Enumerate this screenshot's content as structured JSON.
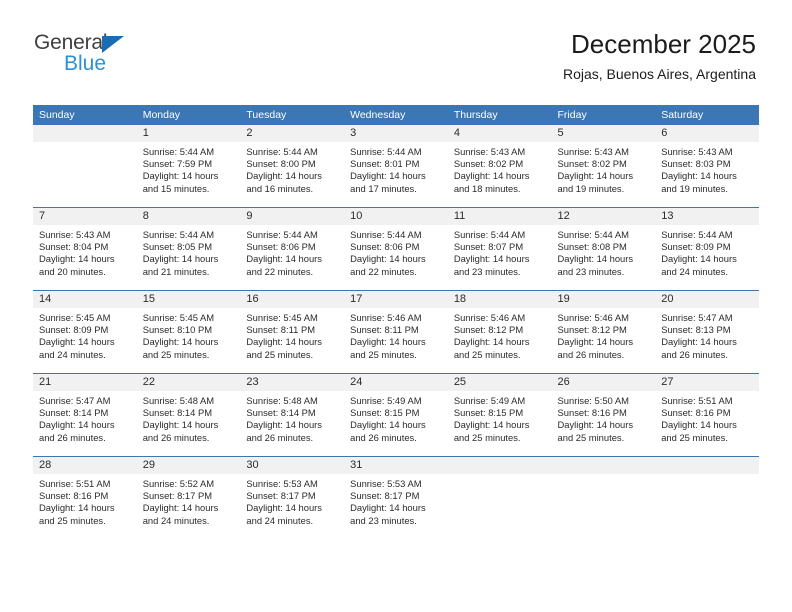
{
  "brand": {
    "name_top": "General",
    "name_bottom": "Blue",
    "accent_color": "#1a6cb5",
    "accent_light": "#2e8fd6"
  },
  "header": {
    "title": "December 2025",
    "subtitle": "Rojas, Buenos Aires, Argentina"
  },
  "theme": {
    "header_bg": "#3b77b5",
    "daynum_bg": "#f1f1f1",
    "text": "#2b2b2b"
  },
  "weekday_headers": [
    "Sunday",
    "Monday",
    "Tuesday",
    "Wednesday",
    "Thursday",
    "Friday",
    "Saturday"
  ],
  "weeks": [
    [
      {
        "day": "",
        "sunrise": "",
        "sunset": "",
        "daylight_line1": "",
        "daylight_line2": ""
      },
      {
        "day": "1",
        "sunrise": "Sunrise: 5:44 AM",
        "sunset": "Sunset: 7:59 PM",
        "daylight_line1": "Daylight: 14 hours",
        "daylight_line2": "and 15 minutes."
      },
      {
        "day": "2",
        "sunrise": "Sunrise: 5:44 AM",
        "sunset": "Sunset: 8:00 PM",
        "daylight_line1": "Daylight: 14 hours",
        "daylight_line2": "and 16 minutes."
      },
      {
        "day": "3",
        "sunrise": "Sunrise: 5:44 AM",
        "sunset": "Sunset: 8:01 PM",
        "daylight_line1": "Daylight: 14 hours",
        "daylight_line2": "and 17 minutes."
      },
      {
        "day": "4",
        "sunrise": "Sunrise: 5:43 AM",
        "sunset": "Sunset: 8:02 PM",
        "daylight_line1": "Daylight: 14 hours",
        "daylight_line2": "and 18 minutes."
      },
      {
        "day": "5",
        "sunrise": "Sunrise: 5:43 AM",
        "sunset": "Sunset: 8:02 PM",
        "daylight_line1": "Daylight: 14 hours",
        "daylight_line2": "and 19 minutes."
      },
      {
        "day": "6",
        "sunrise": "Sunrise: 5:43 AM",
        "sunset": "Sunset: 8:03 PM",
        "daylight_line1": "Daylight: 14 hours",
        "daylight_line2": "and 19 minutes."
      }
    ],
    [
      {
        "day": "7",
        "sunrise": "Sunrise: 5:43 AM",
        "sunset": "Sunset: 8:04 PM",
        "daylight_line1": "Daylight: 14 hours",
        "daylight_line2": "and 20 minutes."
      },
      {
        "day": "8",
        "sunrise": "Sunrise: 5:44 AM",
        "sunset": "Sunset: 8:05 PM",
        "daylight_line1": "Daylight: 14 hours",
        "daylight_line2": "and 21 minutes."
      },
      {
        "day": "9",
        "sunrise": "Sunrise: 5:44 AM",
        "sunset": "Sunset: 8:06 PM",
        "daylight_line1": "Daylight: 14 hours",
        "daylight_line2": "and 22 minutes."
      },
      {
        "day": "10",
        "sunrise": "Sunrise: 5:44 AM",
        "sunset": "Sunset: 8:06 PM",
        "daylight_line1": "Daylight: 14 hours",
        "daylight_line2": "and 22 minutes."
      },
      {
        "day": "11",
        "sunrise": "Sunrise: 5:44 AM",
        "sunset": "Sunset: 8:07 PM",
        "daylight_line1": "Daylight: 14 hours",
        "daylight_line2": "and 23 minutes."
      },
      {
        "day": "12",
        "sunrise": "Sunrise: 5:44 AM",
        "sunset": "Sunset: 8:08 PM",
        "daylight_line1": "Daylight: 14 hours",
        "daylight_line2": "and 23 minutes."
      },
      {
        "day": "13",
        "sunrise": "Sunrise: 5:44 AM",
        "sunset": "Sunset: 8:09 PM",
        "daylight_line1": "Daylight: 14 hours",
        "daylight_line2": "and 24 minutes."
      }
    ],
    [
      {
        "day": "14",
        "sunrise": "Sunrise: 5:45 AM",
        "sunset": "Sunset: 8:09 PM",
        "daylight_line1": "Daylight: 14 hours",
        "daylight_line2": "and 24 minutes."
      },
      {
        "day": "15",
        "sunrise": "Sunrise: 5:45 AM",
        "sunset": "Sunset: 8:10 PM",
        "daylight_line1": "Daylight: 14 hours",
        "daylight_line2": "and 25 minutes."
      },
      {
        "day": "16",
        "sunrise": "Sunrise: 5:45 AM",
        "sunset": "Sunset: 8:11 PM",
        "daylight_line1": "Daylight: 14 hours",
        "daylight_line2": "and 25 minutes."
      },
      {
        "day": "17",
        "sunrise": "Sunrise: 5:46 AM",
        "sunset": "Sunset: 8:11 PM",
        "daylight_line1": "Daylight: 14 hours",
        "daylight_line2": "and 25 minutes."
      },
      {
        "day": "18",
        "sunrise": "Sunrise: 5:46 AM",
        "sunset": "Sunset: 8:12 PM",
        "daylight_line1": "Daylight: 14 hours",
        "daylight_line2": "and 25 minutes."
      },
      {
        "day": "19",
        "sunrise": "Sunrise: 5:46 AM",
        "sunset": "Sunset: 8:12 PM",
        "daylight_line1": "Daylight: 14 hours",
        "daylight_line2": "and 26 minutes."
      },
      {
        "day": "20",
        "sunrise": "Sunrise: 5:47 AM",
        "sunset": "Sunset: 8:13 PM",
        "daylight_line1": "Daylight: 14 hours",
        "daylight_line2": "and 26 minutes."
      }
    ],
    [
      {
        "day": "21",
        "sunrise": "Sunrise: 5:47 AM",
        "sunset": "Sunset: 8:14 PM",
        "daylight_line1": "Daylight: 14 hours",
        "daylight_line2": "and 26 minutes."
      },
      {
        "day": "22",
        "sunrise": "Sunrise: 5:48 AM",
        "sunset": "Sunset: 8:14 PM",
        "daylight_line1": "Daylight: 14 hours",
        "daylight_line2": "and 26 minutes."
      },
      {
        "day": "23",
        "sunrise": "Sunrise: 5:48 AM",
        "sunset": "Sunset: 8:14 PM",
        "daylight_line1": "Daylight: 14 hours",
        "daylight_line2": "and 26 minutes."
      },
      {
        "day": "24",
        "sunrise": "Sunrise: 5:49 AM",
        "sunset": "Sunset: 8:15 PM",
        "daylight_line1": "Daylight: 14 hours",
        "daylight_line2": "and 26 minutes."
      },
      {
        "day": "25",
        "sunrise": "Sunrise: 5:49 AM",
        "sunset": "Sunset: 8:15 PM",
        "daylight_line1": "Daylight: 14 hours",
        "daylight_line2": "and 25 minutes."
      },
      {
        "day": "26",
        "sunrise": "Sunrise: 5:50 AM",
        "sunset": "Sunset: 8:16 PM",
        "daylight_line1": "Daylight: 14 hours",
        "daylight_line2": "and 25 minutes."
      },
      {
        "day": "27",
        "sunrise": "Sunrise: 5:51 AM",
        "sunset": "Sunset: 8:16 PM",
        "daylight_line1": "Daylight: 14 hours",
        "daylight_line2": "and 25 minutes."
      }
    ],
    [
      {
        "day": "28",
        "sunrise": "Sunrise: 5:51 AM",
        "sunset": "Sunset: 8:16 PM",
        "daylight_line1": "Daylight: 14 hours",
        "daylight_line2": "and 25 minutes."
      },
      {
        "day": "29",
        "sunrise": "Sunrise: 5:52 AM",
        "sunset": "Sunset: 8:17 PM",
        "daylight_line1": "Daylight: 14 hours",
        "daylight_line2": "and 24 minutes."
      },
      {
        "day": "30",
        "sunrise": "Sunrise: 5:53 AM",
        "sunset": "Sunset: 8:17 PM",
        "daylight_line1": "Daylight: 14 hours",
        "daylight_line2": "and 24 minutes."
      },
      {
        "day": "31",
        "sunrise": "Sunrise: 5:53 AM",
        "sunset": "Sunset: 8:17 PM",
        "daylight_line1": "Daylight: 14 hours",
        "daylight_line2": "and 23 minutes."
      },
      {
        "day": "",
        "sunrise": "",
        "sunset": "",
        "daylight_line1": "",
        "daylight_line2": ""
      },
      {
        "day": "",
        "sunrise": "",
        "sunset": "",
        "daylight_line1": "",
        "daylight_line2": ""
      },
      {
        "day": "",
        "sunrise": "",
        "sunset": "",
        "daylight_line1": "",
        "daylight_line2": ""
      }
    ]
  ]
}
